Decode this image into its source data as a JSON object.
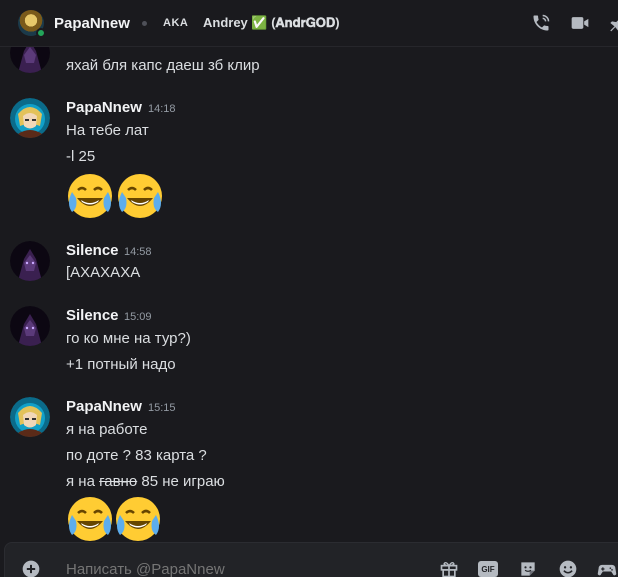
{
  "header": {
    "name": "PapaNnew",
    "aka_label": "AKA",
    "aka_value": "Andrey ✅ (𝐀𝐧𝐝𝐫𝐆𝐎𝐃)",
    "icons": [
      "phone-call-icon",
      "video-call-icon",
      "pin-icon"
    ]
  },
  "messages": [
    {
      "author": "Silence",
      "time": "",
      "lines": [
        "яхай бля капс даеш зб клир"
      ],
      "continued": true
    },
    {
      "author": "PapaNnew",
      "time": "14:18",
      "lines": [
        "На тебе лат",
        "-l 25"
      ],
      "emojis": [
        "😂",
        "😂"
      ]
    },
    {
      "author": "Silence",
      "time": "14:58",
      "lines": [
        "[АХАХАХА"
      ]
    },
    {
      "author": "Silence",
      "time": "15:09",
      "lines": [
        "го ко мне на тур?)",
        "+1 потный надо"
      ]
    },
    {
      "author": "PapaNnew",
      "time": "15:15",
      "lines": [
        "я на работе",
        "по доте ? 83 карта ?"
      ],
      "strike_line": {
        "before": "я на ",
        "struck": "гавно",
        "after": " 85 не играю"
      },
      "emojis": [
        "😂",
        "😂"
      ]
    }
  ],
  "composer": {
    "placeholder": "Написать @PapaNnew",
    "icons": [
      "add-icon",
      "gift-icon",
      "gif-icon",
      "sticker-icon",
      "emoji-icon",
      "gamepad-icon"
    ],
    "gif_label": "GIF"
  },
  "colors": {
    "background": "#1a1a1e",
    "text": "#dbdee1",
    "timestamp": "#949ba4",
    "online": "#23a55a"
  }
}
